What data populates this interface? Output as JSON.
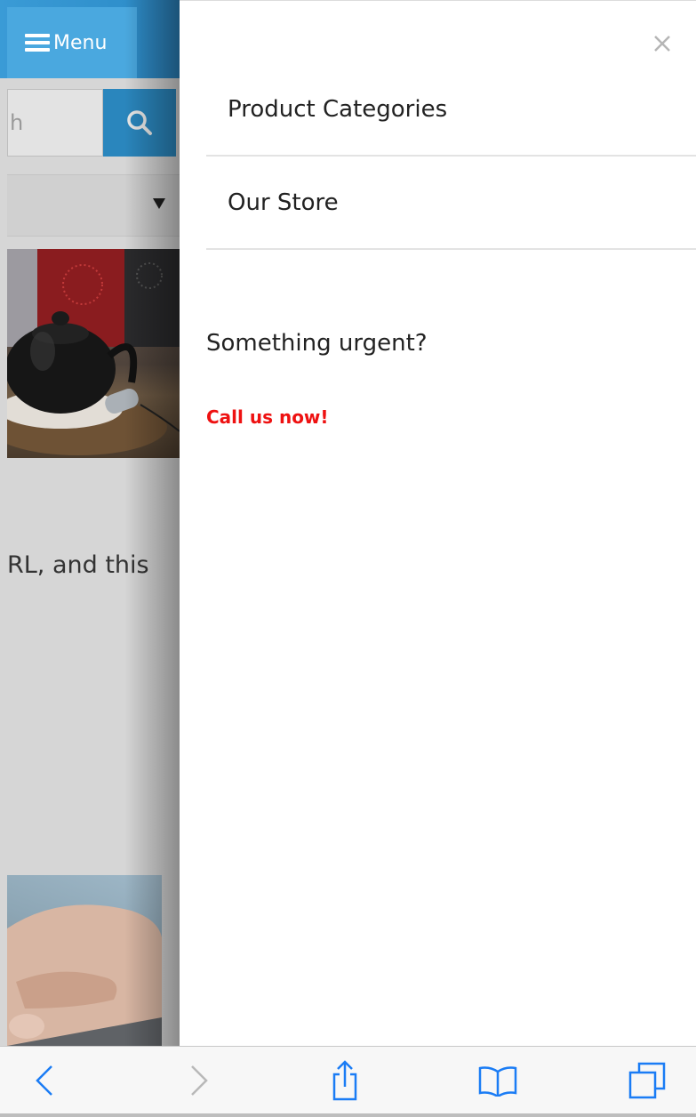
{
  "background_page": {
    "menu_label": "Menu",
    "search_placeholder": "h",
    "partial_text": "RL, and this"
  },
  "drawer": {
    "items": [
      {
        "label": "Product Categories"
      },
      {
        "label": "Our Store"
      }
    ],
    "urgent_heading": "Something urgent?",
    "call_link": "Call us now!",
    "close_icon": "close-icon"
  },
  "toolbar": {
    "icons": [
      "chevron-left-icon",
      "chevron-right-icon",
      "share-icon",
      "bookmarks-icon",
      "tabs-icon"
    ]
  },
  "colors": {
    "menu_bar": "#3a9bd6",
    "search_button": "#2a86bd",
    "call_link": "#ee1111",
    "toolbar_icon": "#1a7cf5",
    "toolbar_icon_disabled": "#b8b8b8"
  }
}
